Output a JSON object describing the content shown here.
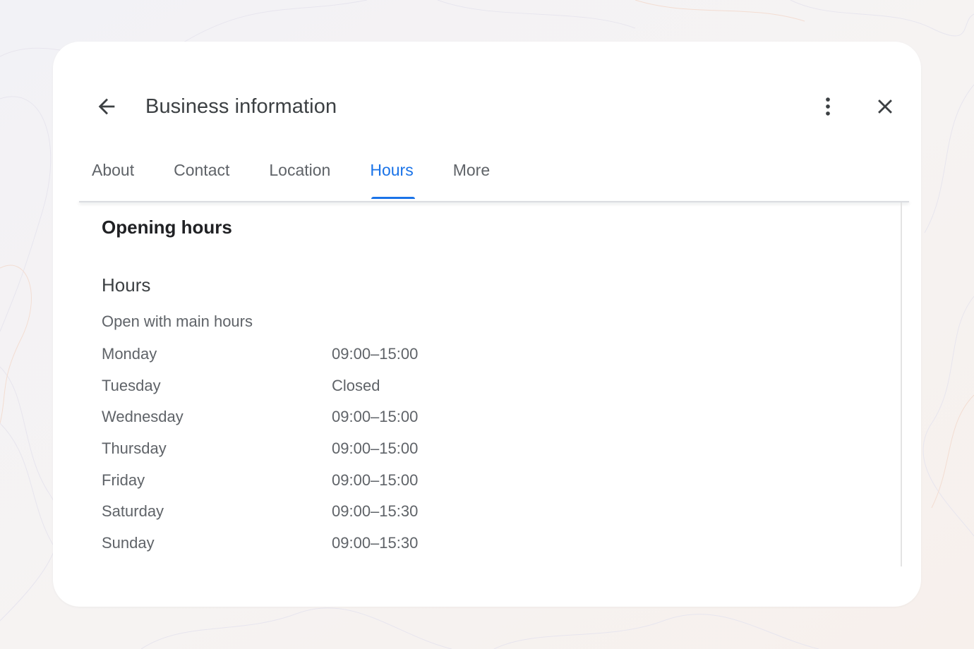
{
  "dialog": {
    "title": "Business information",
    "icons": {
      "back": "arrow-back-icon",
      "more": "more-vertical-icon",
      "close": "close-icon"
    }
  },
  "tabs": [
    {
      "label": "About",
      "active": false
    },
    {
      "label": "Contact",
      "active": false
    },
    {
      "label": "Location",
      "active": false
    },
    {
      "label": "Hours",
      "active": true
    },
    {
      "label": "More",
      "active": false
    }
  ],
  "content": {
    "section_title": "Opening hours",
    "subsection_title": "Hours",
    "status": "Open with main hours",
    "hours": [
      {
        "day": "Monday",
        "time": "09:00–15:00"
      },
      {
        "day": "Tuesday",
        "time": "Closed"
      },
      {
        "day": "Wednesday",
        "time": "09:00–15:00"
      },
      {
        "day": "Thursday",
        "time": "09:00–15:00"
      },
      {
        "day": "Friday",
        "time": "09:00–15:00"
      },
      {
        "day": "Saturday",
        "time": "09:00–15:30"
      },
      {
        "day": "Sunday",
        "time": "09:00–15:30"
      }
    ]
  },
  "colors": {
    "accent": "#1a73e8",
    "text_primary": "#202124",
    "text_secondary": "#5f6368",
    "background": "#f4f3f5",
    "card": "#ffffff"
  }
}
